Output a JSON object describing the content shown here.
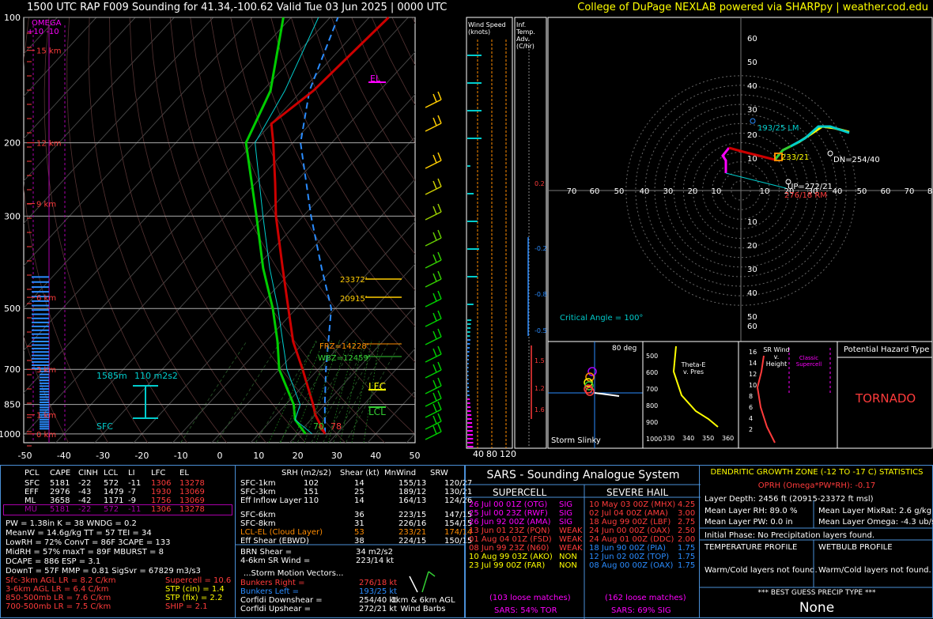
{
  "header": {
    "title": "1500 UTC RAP F009 Sounding for 41.34,-100.62 Valid  Tue 03 Jun 2025 | 0000 UTC",
    "credit": "College of DuPage NEXLAB powered via SHARPpy | weather.cod.edu"
  },
  "colors": {
    "temp": "#cc0000",
    "dew": "#00cc00",
    "parcel": "#2a8cff",
    "wetbulb": "#00cccc",
    "accent": "#ffff00",
    "magenta": "#ff00ff"
  },
  "chart_data": [
    {
      "type": "skew-t",
      "title": "",
      "y_ticks": [
        "100",
        "200",
        "300",
        "500",
        "700",
        "850",
        "1000"
      ],
      "x_ticks": [
        "-50",
        "-40",
        "-30",
        "-20",
        "-10",
        "0",
        "10",
        "20",
        "30",
        "40",
        "50"
      ],
      "height_labels": [
        "15 km",
        "12 km",
        "9 km",
        "6 km",
        "3 km",
        "1 km",
        "0 km"
      ],
      "temperature": [
        [
          1000,
          27
        ],
        [
          900,
          20
        ],
        [
          850,
          17
        ],
        [
          700,
          6
        ],
        [
          600,
          -3
        ],
        [
          500,
          -12
        ],
        [
          400,
          -23
        ],
        [
          300,
          -37
        ],
        [
          250,
          -45
        ],
        [
          200,
          -55
        ],
        [
          180,
          -60
        ],
        [
          150,
          -57
        ],
        [
          100,
          -55
        ]
      ],
      "dewpoint": [
        [
          1000,
          22
        ],
        [
          925,
          16
        ],
        [
          850,
          12
        ],
        [
          700,
          0
        ],
        [
          600,
          -7
        ],
        [
          500,
          -16
        ],
        [
          400,
          -28
        ],
        [
          300,
          -42
        ],
        [
          200,
          -62
        ],
        [
          150,
          -68
        ],
        [
          100,
          -82
        ]
      ],
      "parcel": [
        [
          1000,
          27
        ],
        [
          850,
          20
        ],
        [
          700,
          12
        ],
        [
          500,
          -1
        ],
        [
          400,
          -13
        ],
        [
          300,
          -28
        ],
        [
          200,
          -48
        ],
        [
          150,
          -58
        ],
        [
          100,
          -68
        ]
      ],
      "annotations": {
        "el": "EL",
        "lfc": "LFC",
        "lcl": "LCL",
        "frz": "FRZ=14228'",
        "wbz": "WBZ=12459'",
        "dgz_top": "23372'",
        "dgz_bot": "20915'",
        "eff_inflow_top": "1585m",
        "eff_inflow_srh": "110 m2s2",
        "sfc": "SFC",
        "sfc_t": "78",
        "sfc_td": "70",
        "omega": "OMEGA",
        "omega_scale": "+10  -10"
      },
      "wind_speed_header": "Wind Speed (knots)",
      "wind_speed_ticks": [
        "40",
        "80",
        "120"
      ],
      "inf_temp_header": "Inf. Temp. Adv. (C/hr)",
      "inf_temp_values": [
        "0.2",
        "-0.2",
        "-0.8",
        "-0.5",
        "1.5",
        "1.2",
        "1.6"
      ]
    },
    {
      "type": "hodograph",
      "rings": [
        "10",
        "20",
        "30",
        "40",
        "50",
        "60"
      ],
      "x_ticks": [
        "70",
        "60",
        "50",
        "40",
        "30",
        "20",
        "10",
        "10",
        "20",
        "30",
        "40",
        "50",
        "60",
        "70",
        "8"
      ],
      "y_ticks": [
        "60",
        "50",
        "40",
        "30",
        "20",
        "10",
        "10",
        "20",
        "30",
        "40",
        "50",
        "60"
      ],
      "lm": "193/25 LM",
      "rm": "276/18 RM",
      "dn": "DN=254/40",
      "up": "UP=272/21",
      "mean": "233/21",
      "critical_angle": "Critical Angle = 100°"
    }
  ],
  "mini": {
    "slinky_deg": "80 deg",
    "slinky_label": "Storm Slinky",
    "theta_label": "Theta-E v. Pres",
    "theta_y": [
      "500",
      "600",
      "700",
      "800",
      "900",
      "1000"
    ],
    "theta_x": [
      "330",
      "340",
      "350",
      "360"
    ],
    "srw_label": "SR Wind v. Height",
    "srw_note": "Classic Supercell",
    "srw_y": [
      "16",
      "14",
      "12",
      "10",
      "8",
      "6",
      "4",
      "2"
    ],
    "hazard_title": "Potential Hazard Type",
    "hazard": "TORNADO"
  },
  "parcels": {
    "headers": [
      "PCL",
      "CAPE",
      "CINH",
      "LCL",
      "LI",
      "LFC",
      "EL"
    ],
    "rows": [
      [
        "SFC",
        "5181",
        "-22",
        "572",
        "-11",
        "1306",
        "13278"
      ],
      [
        "EFF",
        "2976",
        "-43",
        "1479",
        "-7",
        "1930",
        "13069"
      ],
      [
        "ML",
        "3658",
        "-42",
        "1171",
        "-9",
        "1756",
        "13069"
      ],
      [
        "MU",
        "5181",
        "-22",
        "572",
        "-11",
        "1306",
        "13278"
      ]
    ]
  },
  "indices": [
    "PW = 1.38in        K = 38        WNDG = 0.2",
    "MeanW = 14.6g/kg   TT = 57       TEI = 34",
    "LowRH = 72%        ConvT = 86F   3CAPE = 133",
    "MidRH = 57%        maxT = 89F    MBURST = 8",
    "DCAPE = 886        ESP = 3.1",
    "DownT = 57F        MMP = 0.81    SigSvr = 67829 m3/s3"
  ],
  "lapse": [
    {
      "t": "Sfc-3km AGL LR = 8.2 C/km",
      "c": "#ff3b3b"
    },
    {
      "t": "3-6km AGL LR = 6.4 C/km",
      "c": "#ff3b3b"
    },
    {
      "t": "850-500mb LR = 7.6 C/km",
      "c": "#ff3b3b"
    },
    {
      "t": "700-500mb LR = 7.5 C/km",
      "c": "#ff3b3b"
    }
  ],
  "composite": [
    {
      "t": "Supercell = 10.6",
      "c": "#ff3b3b"
    },
    {
      "t": "STP (cin) = 1.4",
      "c": "#ffff00"
    },
    {
      "t": "STP (fix) = 2.2",
      "c": "#ffff00"
    },
    {
      "t": "SHIP = 2.1",
      "c": "#ff3b3b"
    }
  ],
  "kinematics": {
    "headers": [
      "SRH (m2/s2)",
      "Shear (kt)",
      "MnWind",
      "SRW"
    ],
    "rows": [
      {
        "n": "SFC-1km",
        "v": [
          "102",
          "14",
          "155/13",
          "120/27"
        ],
        "c": "#ffffff"
      },
      {
        "n": "SFC-3km",
        "v": [
          "151",
          "25",
          "189/12",
          "130/21"
        ],
        "c": "#ffffff"
      },
      {
        "n": "Eff Inflow Layer",
        "v": [
          "110",
          "14",
          "164/13",
          "124/26"
        ],
        "c": "#ffffff"
      },
      {
        "n": "SFC-6km",
        "v": [
          "",
          "36",
          "223/15",
          "147/15"
        ],
        "c": "#ffffff"
      },
      {
        "n": "SFC-8km",
        "v": [
          "",
          "31",
          "226/16",
          "154/15"
        ],
        "c": "#ffffff"
      },
      {
        "n": "LCL-EL (Cloud Layer)",
        "v": [
          "",
          "53",
          "233/21",
          "174/14"
        ],
        "c": "#ff8c00"
      },
      {
        "n": "Eff Shear (EBWD)",
        "v": [
          "",
          "38",
          "224/15",
          "150/15"
        ],
        "c": "#ffffff"
      }
    ],
    "brn": "BRN Shear =",
    "brn_v": "34 m2/s2",
    "sr46": "4-6km SR Wind =",
    "sr46_v": "223/14 kt",
    "storm_title": "...Storm Motion Vectors...",
    "storm": [
      {
        "n": "Bunkers Right =",
        "v": "276/18 kt",
        "c": "#ff3b3b"
      },
      {
        "n": "Bunkers Left =",
        "v": "193/25 kt",
        "c": "#2a8cff"
      },
      {
        "n": "Corfidi Downshear =",
        "v": "254/40 kt",
        "c": "#ffffff"
      },
      {
        "n": "Corfidi Upshear =",
        "v": "272/21 kt",
        "c": "#ffffff"
      }
    ],
    "barb_label": "1km & 6km AGL Wind Barbs"
  },
  "sars": {
    "title": "SARS - Sounding Analogue System",
    "supercell_title": "SUPERCELL",
    "hail_title": "SEVERE HAIL",
    "supercell": [
      {
        "t": "26 Jul 00 01Z (OTG)",
        "v": "SIG",
        "c": "#ff00ff"
      },
      {
        "t": "25 Jul 00 23Z (RWF)",
        "v": "SIG",
        "c": "#ff00ff"
      },
      {
        "t": "26 Jun 92 00Z (AMA)",
        "v": "SIG",
        "c": "#ff00ff"
      },
      {
        "t": "13 Jun 01 23Z (PQN)",
        "v": "WEAK",
        "c": "#ff3b3b"
      },
      {
        "t": "01 Aug 04 01Z (FSD)",
        "v": "WEAK",
        "c": "#ff3b3b"
      },
      {
        "t": "08 Jun 99 23Z (N60)",
        "v": "WEAK",
        "c": "#ff3b3b"
      },
      {
        "t": "10 Aug 99 03Z (AKO)",
        "v": "NON",
        "c": "#ffff00"
      },
      {
        "t": "23 Jul 99 00Z (FAR)",
        "v": "NON",
        "c": "#ffff00"
      }
    ],
    "hail": [
      {
        "t": "10 May 03 00Z (MHX)",
        "v": "4.25",
        "c": "#ff3b3b"
      },
      {
        "t": "02 Jul 04 00Z (AMA)",
        "v": "3.00",
        "c": "#ff3b3b"
      },
      {
        "t": "18 Aug 99 00Z (LBF)",
        "v": "2.75",
        "c": "#ff3b3b"
      },
      {
        "t": "24 Jun 00 00Z (OAX)",
        "v": "2.50",
        "c": "#ff3b3b"
      },
      {
        "t": "24 Aug 01 00Z (DDC)",
        "v": "2.00",
        "c": "#ff3b3b"
      },
      {
        "t": "18 Jun 90 00Z (PIA)",
        "v": "1.75",
        "c": "#2a8cff"
      },
      {
        "t": "12 Jun 02 00Z (TOP)",
        "v": "1.75",
        "c": "#2a8cff"
      },
      {
        "t": "08 Aug 00 00Z (OAX)",
        "v": "1.75",
        "c": "#2a8cff"
      }
    ],
    "sc_matches": "(103 loose matches)",
    "hail_matches": "(162 loose matches)",
    "sc_prob": "SARS: 54% TOR",
    "hail_prob": "SARS: 69% SIG"
  },
  "dgz": {
    "title": "DENDRITIC GROWTH ZONE (-12 TO -17 C) STATISTICS",
    "oprh": "OPRH (Omega*PW*RH): -0.17",
    "depth": "Layer Depth: 2456 ft (20915-23372 ft msl)",
    "rh": "Mean Layer RH: 89.0 %",
    "mix": "Mean Layer MixRat: 2.6 g/kg",
    "pw": "Mean Layer PW: 0.0 in",
    "omega": "Mean Layer Omega: -4.3 ub/s",
    "phase": "Initial Phase:  No Precipitation layers found.",
    "temp_title": "TEMPERATURE PROFILE",
    "wb_title": "WETBULB PROFILE",
    "temp_msg": "Warm/Cold layers not found.",
    "wb_msg": "Warm/Cold layers not found.",
    "precip_title": "*** BEST GUESS PRECIP TYPE ***",
    "precip": "None"
  }
}
